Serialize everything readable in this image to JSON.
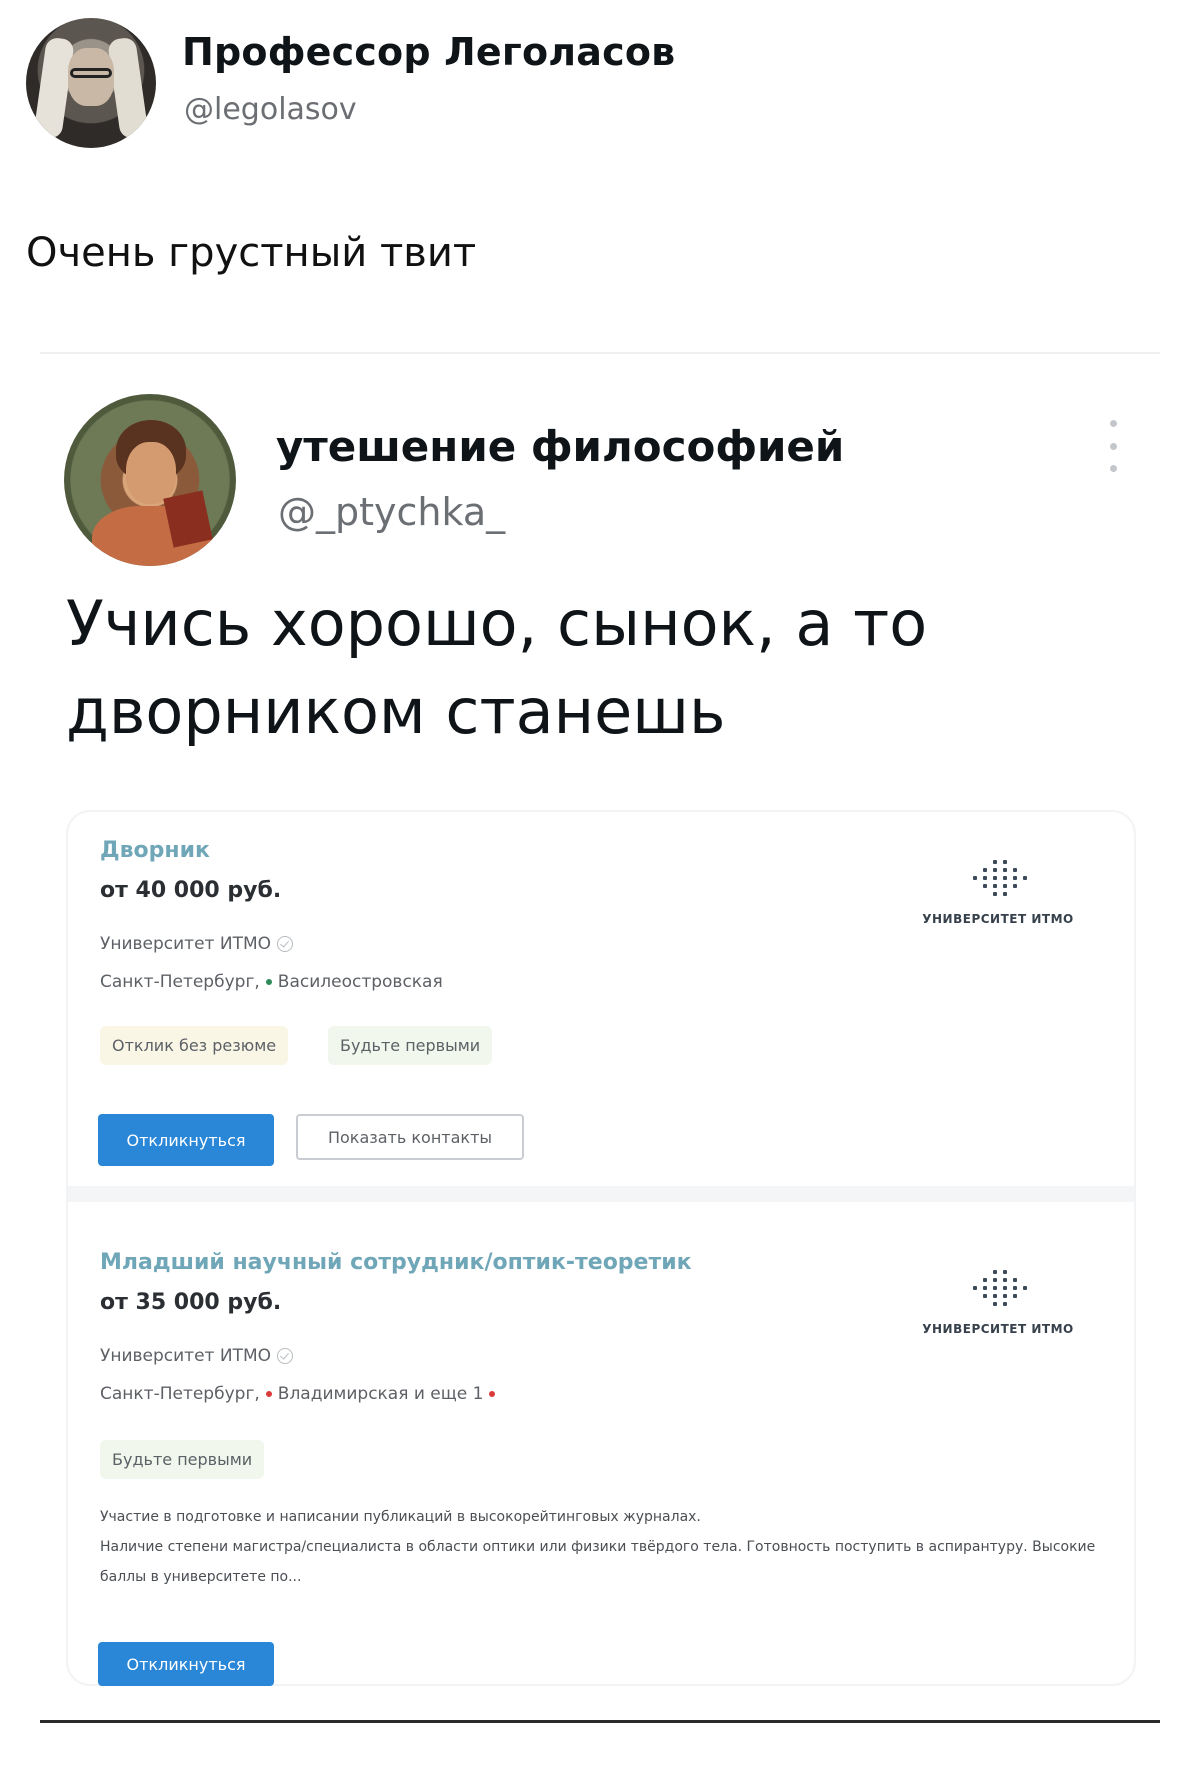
{
  "outer_tweet": {
    "author_name": "Профессор Леголасов",
    "author_handle": "@legolasov",
    "text": "Очень грустный твит"
  },
  "inner_tweet": {
    "author_name": "утешение философией",
    "author_handle": "@_ptychka_",
    "text": "Учись хорошо, сынок, а то дворником станешь",
    "more_icon": "more-vertical-icon"
  },
  "vacancies": [
    {
      "title": "Дворник",
      "salary": "от 40 000 руб.",
      "employer": "Университет ИТМО",
      "location": "Санкт-Петербург,",
      "metro": "Василеостровская",
      "metro_color": "#2e8b57",
      "tags": [
        "Отклик без резюме",
        "Будьте первыми"
      ],
      "apply_button": "Откликнуться",
      "contacts_button": "Показать контакты",
      "logo_text": "УНИВЕРСИТЕТ ИТМО"
    },
    {
      "title": "Младший научный сотрудник/оптик-теоретик",
      "salary": "от 35 000 руб.",
      "employer": "Университет ИТМО",
      "location": "Санкт-Петербург,",
      "metro": "Владимирская и еще 1",
      "metro_color": "#d93a3a",
      "tags": [
        "Будьте первыми"
      ],
      "description_1": "Участие в подготовке и написании публикаций в высокорейтинговых журналах.",
      "description_2": "Наличие степени магистра/специалиста в области оптики или физики твёрдого тела. Готовность поступить в аспирантуру. Высокие баллы в университете по...",
      "apply_button": "Откликнуться",
      "logo_text": "УНИВЕРСИТЕТ ИТМО"
    }
  ]
}
